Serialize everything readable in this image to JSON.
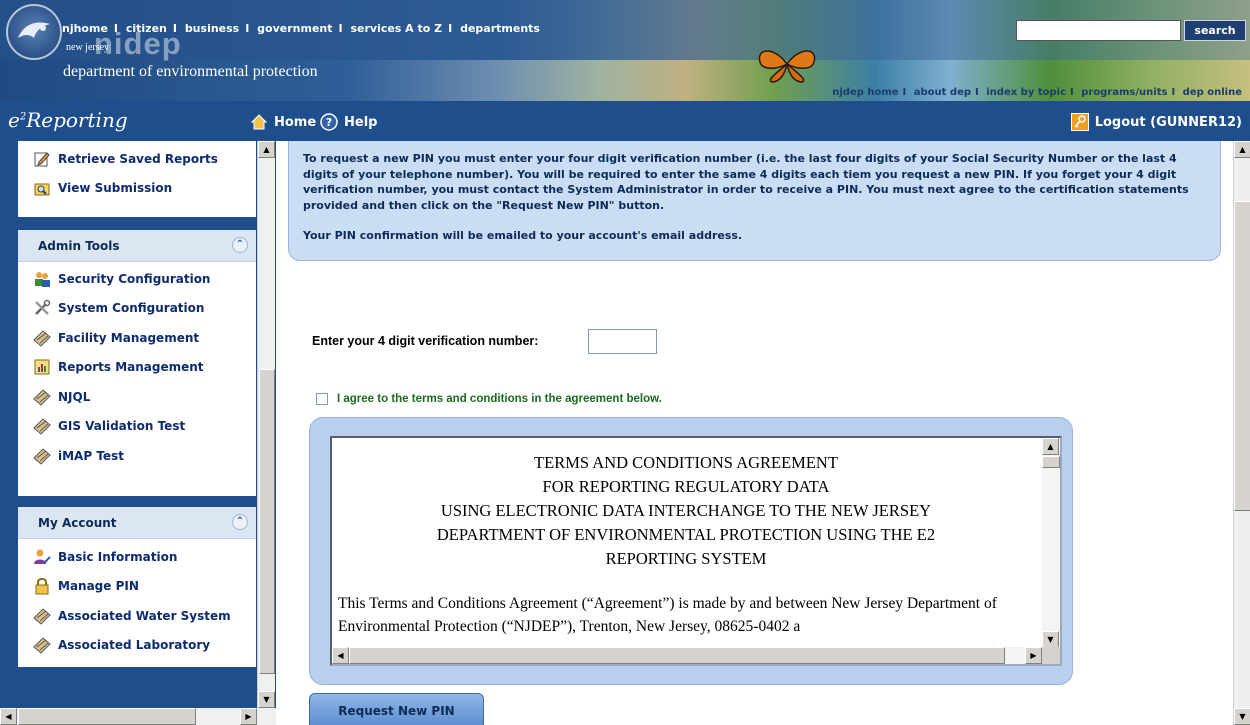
{
  "banner": {
    "top_nav": [
      "njhome",
      "citizen",
      "business",
      "government",
      "services A to Z",
      "departments"
    ],
    "separator": "I",
    "logo_small": "new jersey",
    "logo_big": "nidep",
    "logo_line": "department of environmental protection",
    "search_placeholder": "",
    "search_label": "search",
    "sub_nav": [
      "njdep home",
      "about dep",
      "index by topic",
      "programs/units",
      "dep online"
    ]
  },
  "appbar": {
    "logo": "e",
    "logo_sup": "2",
    "logo_rest": "Reporting",
    "home_label": "Home",
    "help_label": "Help",
    "logout_label": "Logout (GUNNER12)"
  },
  "sidebar": {
    "reports_items": [
      {
        "label": "Retrieve Saved Reports",
        "icon": "edit-icon"
      },
      {
        "label": "View Submission",
        "icon": "view-icon"
      }
    ],
    "admin_title": "Admin Tools",
    "admin_items": [
      {
        "label": "Security Configuration",
        "icon": "users-icon"
      },
      {
        "label": "System Configuration",
        "icon": "tools-icon"
      },
      {
        "label": "Facility Management",
        "icon": "pencil-icon"
      },
      {
        "label": "Reports Management",
        "icon": "report-icon"
      },
      {
        "label": "NJQL",
        "icon": "pencil-icon"
      },
      {
        "label": "GIS Validation Test",
        "icon": "pencil-icon"
      },
      {
        "label": "iMAP Test",
        "icon": "pencil-icon"
      }
    ],
    "account_title": "My Account",
    "account_items": [
      {
        "label": "Basic Information",
        "icon": "user-icon"
      },
      {
        "label": "Manage PIN",
        "icon": "lock-icon"
      },
      {
        "label": "Associated Water System",
        "icon": "pencil-icon"
      },
      {
        "label": "Associated Laboratory",
        "icon": "pencil-icon"
      }
    ]
  },
  "main": {
    "info_p1": "To request a new PIN you must enter your four digit verification number (i.e. the last four digits of your Social Security Number or the last 4 digits of your telephone number). You will be required to enter the same 4 digits each tiem you request a new PIN. If you forget your 4 digit verification number, you must contact the System Administrator in order to receive a PIN. You must next agree to the certification statements provided and then click on the \"Request New PIN\" button.",
    "info_p2": "Your PIN confirmation will be emailed to your account's email address.",
    "verif_label": "Enter your 4 digit verification number:",
    "verif_value": "",
    "agree_label": "I agree to the terms and conditions in the agreement below.",
    "terms_title_lines": [
      "TERMS AND CONDITIONS AGREEMENT",
      "FOR REPORTING REGULATORY DATA",
      "USING ELECTRONIC DATA INTERCHANGE TO THE NEW JERSEY",
      "DEPARTMENT OF ENVIRONMENTAL PROTECTION USING THE E2",
      "REPORTING SYSTEM"
    ],
    "terms_body": "This Terms and Conditions Agreement (“Agreement”) is made by and between New Jersey Department of Environmental Protection (“NJDEP”), Trenton, New Jersey, 08625-0402 a",
    "request_button": "Request New PIN"
  },
  "colors": {
    "navy": "#1f4e8c",
    "panel_head": "#dce6f3",
    "info_bg": "#c9ddf5",
    "agree_green": "#1e6a1e"
  }
}
